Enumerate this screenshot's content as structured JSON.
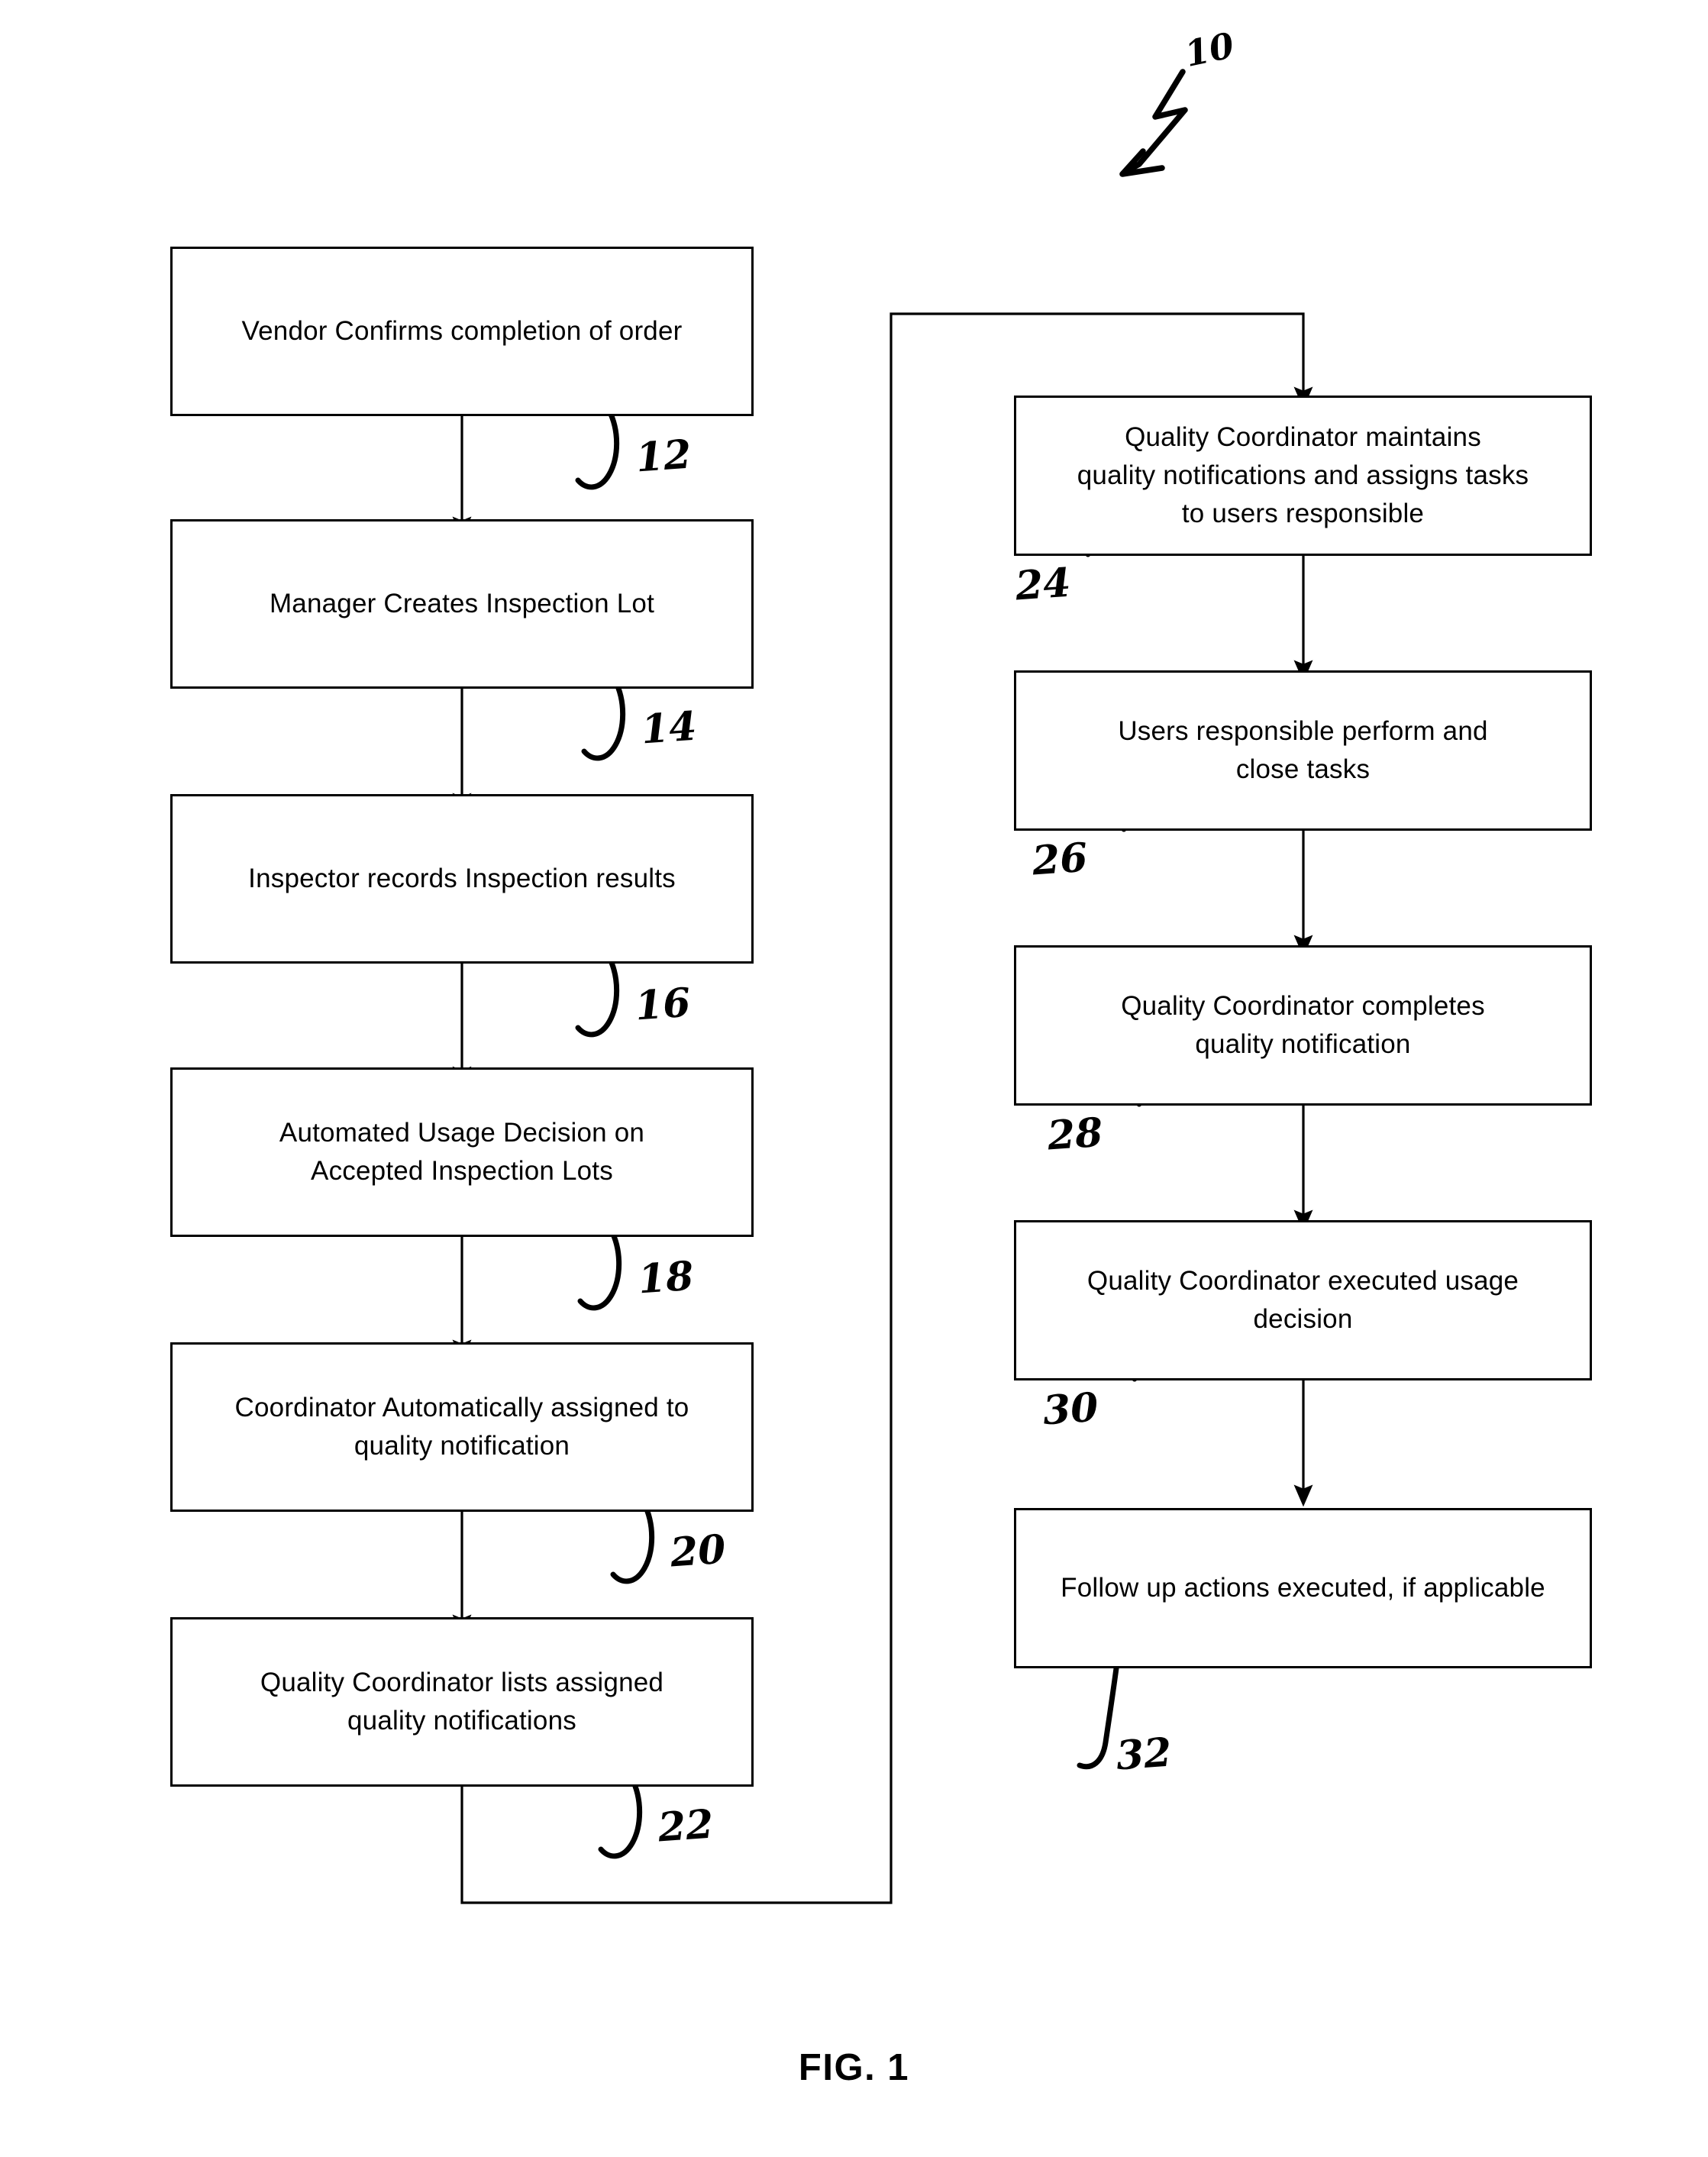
{
  "figure": {
    "caption": "FIG. 1",
    "overall_label": "10"
  },
  "colors": {
    "ink": "#000000",
    "paper": "#ffffff"
  },
  "flow": {
    "left_column": [
      {
        "ref": "12",
        "text": "Vendor Confirms completion of order"
      },
      {
        "ref": "14",
        "text": "Manager Creates Inspection Lot"
      },
      {
        "ref": "16",
        "text": "Inspector records Inspection results"
      },
      {
        "ref": "18",
        "text": "Automated Usage Decision on\nAccepted Inspection Lots"
      },
      {
        "ref": "20",
        "text": "Coordinator Automatically assigned to\nquality notification"
      },
      {
        "ref": "22",
        "text": "Quality Coordinator lists assigned\nquality notifications"
      }
    ],
    "right_column": [
      {
        "ref": "24",
        "text": "Quality Coordinator maintains\nquality notifications and assigns tasks\nto users responsible"
      },
      {
        "ref": "26",
        "text": "Users responsible perform and\nclose tasks"
      },
      {
        "ref": "28",
        "text": "Quality Coordinator completes\nquality notification"
      },
      {
        "ref": "30",
        "text": "Quality Coordinator executed usage\ndecision"
      },
      {
        "ref": "32",
        "text": "Follow up actions executed, if applicable"
      }
    ]
  },
  "chart_data": {
    "type": "flowchart",
    "title": "FIG. 1",
    "nodes": [
      {
        "id": "12",
        "label": "Vendor Confirms completion of order",
        "column": "left",
        "order": 1
      },
      {
        "id": "14",
        "label": "Manager Creates Inspection Lot",
        "column": "left",
        "order": 2
      },
      {
        "id": "16",
        "label": "Inspector records Inspection results",
        "column": "left",
        "order": 3
      },
      {
        "id": "18",
        "label": "Automated Usage Decision on Accepted Inspection Lots",
        "column": "left",
        "order": 4
      },
      {
        "id": "20",
        "label": "Coordinator Automatically assigned to quality notification",
        "column": "left",
        "order": 5
      },
      {
        "id": "22",
        "label": "Quality Coordinator lists assigned quality notifications",
        "column": "left",
        "order": 6
      },
      {
        "id": "24",
        "label": "Quality Coordinator maintains quality notifications and assigns tasks to users responsible",
        "column": "right",
        "order": 7
      },
      {
        "id": "26",
        "label": "Users responsible perform and close tasks",
        "column": "right",
        "order": 8
      },
      {
        "id": "28",
        "label": "Quality Coordinator completes quality notification",
        "column": "right",
        "order": 9
      },
      {
        "id": "30",
        "label": "Quality Coordinator executed usage decision",
        "column": "right",
        "order": 10
      },
      {
        "id": "32",
        "label": "Follow up actions executed, if applicable",
        "column": "right",
        "order": 11
      }
    ],
    "edges": [
      {
        "from": "12",
        "to": "14",
        "style": "straight-down"
      },
      {
        "from": "14",
        "to": "16",
        "style": "straight-down"
      },
      {
        "from": "16",
        "to": "18",
        "style": "straight-down"
      },
      {
        "from": "18",
        "to": "20",
        "style": "straight-down"
      },
      {
        "from": "20",
        "to": "22",
        "style": "straight-down"
      },
      {
        "from": "22",
        "to": "24",
        "style": "routed-around-left-then-top"
      },
      {
        "from": "24",
        "to": "26",
        "style": "straight-down"
      },
      {
        "from": "26",
        "to": "28",
        "style": "straight-down"
      },
      {
        "from": "28",
        "to": "30",
        "style": "straight-down"
      },
      {
        "from": "30",
        "to": "32",
        "style": "straight-down"
      }
    ]
  }
}
